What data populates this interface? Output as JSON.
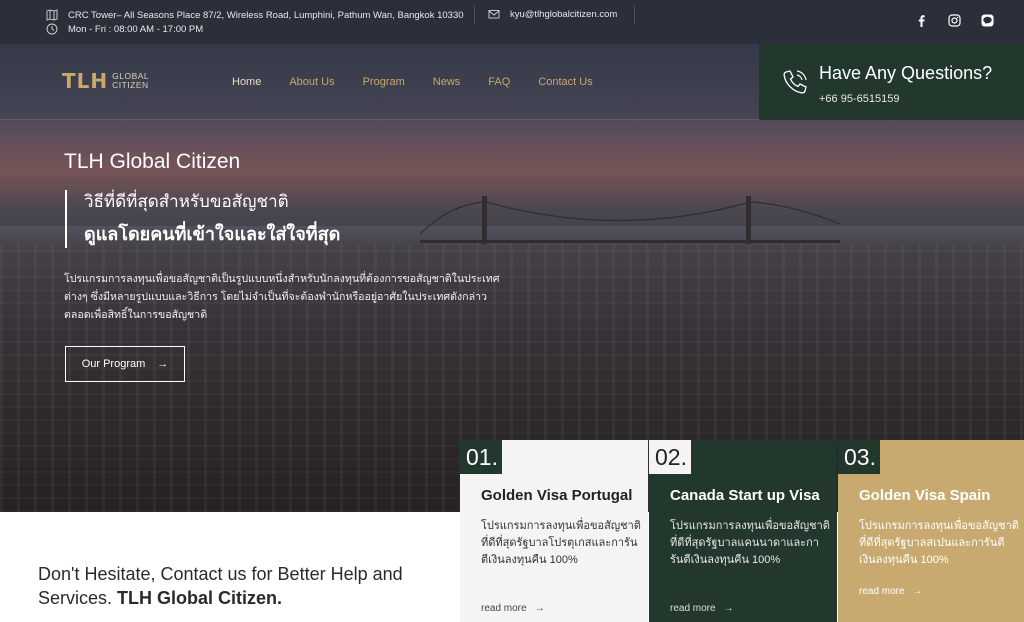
{
  "topbar": {
    "address": "CRC Tower– All Seasons Place 87/2, Wireless Road, Lumphini, Pathum Wan, Bangkok 10330",
    "hours": "Mon - Fri : 08:00 AM - 17:00 PM",
    "email": "kyu@tlhglobalcitizen.com"
  },
  "logo": {
    "mark": "TLH",
    "line1": "GLOBAL",
    "line2": "CITIZEN"
  },
  "nav": {
    "items": [
      {
        "label": "Home"
      },
      {
        "label": "About Us"
      },
      {
        "label": "Program"
      },
      {
        "label": "News"
      },
      {
        "label": "FAQ"
      },
      {
        "label": "Contact Us"
      }
    ]
  },
  "ask": {
    "title": "Have Any Questions?",
    "phone": "+66 95-6515159"
  },
  "hero": {
    "title": "TLH Global Citizen",
    "quote1": "วิธีที่ดีที่สุดสำหรับขอสัญชาติ",
    "quote2": "ดูแลโดยคนที่เข้าใจและใส่ใจที่สุด",
    "description": "โปรแกรมการลงทุนเพื่อขอสัญชาติเป็นรูปแบบหนึ่งสำหรับนักลงทุนที่ต้องการขอสัญชาติในประเทศต่างๆ ซึ่งมีหลายรูปแบบและวิธีการ โดยไม่จำเป็นที่จะต้องพำนักหรืออยู่อาศัยในประเทศดังกล่าวตลอดเพื่อสิทธิ์ในการขอสัญชาติ",
    "button": "Our Program"
  },
  "contact": {
    "text": "Don't Hesitate, Contact us for Better Help and Services.",
    "brand": "TLH Global Citizen."
  },
  "cards": [
    {
      "num": "01.",
      "title": "Golden Visa Portugal",
      "desc": "โปรแกรมการลงทุนเพื่อขอสัญชาติที่ดีที่สุดรัฐบาลโปรตุเกสและการันตีเงินลงทุนคืน 100%",
      "more": "read more"
    },
    {
      "num": "02.",
      "title": "Canada Start up Visa",
      "desc": "โปรแกรมการลงทุนเพื่อขอสัญชาติที่ดีที่สุดรัฐบาลแคนนาดาและการันตีเงินลงทุนคืน 100%",
      "more": "read more"
    },
    {
      "num": "03.",
      "title": "Golden Visa Spain",
      "desc": "โปรแกรมการลงทุนเพื่อขอสัญชาติที่ดีที่สุดรัฐบาลสเปนและการันตีเงินลงทุนคืน 100%",
      "more": "read more"
    }
  ],
  "arrow": "→",
  "colors": {
    "green": "#22382d",
    "gold": "#c8aa70",
    "topbar": "#2b2f3a"
  }
}
